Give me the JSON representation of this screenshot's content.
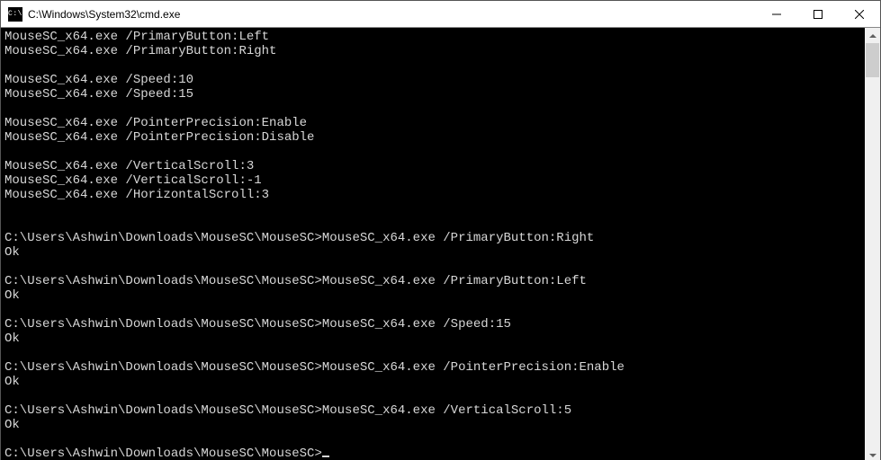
{
  "titlebar": {
    "icon_label": "C:\\",
    "title": "C:\\Windows\\System32\\cmd.exe",
    "minimize_label": "Minimize",
    "maximize_label": "Maximize",
    "close_label": "Close"
  },
  "console": {
    "usage_lines": [
      "MouseSC_x64.exe /PrimaryButton:Left",
      "MouseSC_x64.exe /PrimaryButton:Right",
      "",
      "MouseSC_x64.exe /Speed:10",
      "MouseSC_x64.exe /Speed:15",
      "",
      "MouseSC_x64.exe /PointerPrecision:Enable",
      "MouseSC_x64.exe /PointerPrecision:Disable",
      "",
      "MouseSC_x64.exe /VerticalScroll:3",
      "MouseSC_x64.exe /VerticalScroll:-1",
      "MouseSC_x64.exe /HorizontalScroll:3"
    ],
    "prompt_path": "C:\\Users\\Ashwin\\Downloads\\MouseSC\\MouseSC>",
    "sessions": [
      {
        "cmd": "MouseSC_x64.exe /PrimaryButton:Right",
        "out": "Ok"
      },
      {
        "cmd": "MouseSC_x64.exe /PrimaryButton:Left",
        "out": "Ok"
      },
      {
        "cmd": "MouseSC_x64.exe /Speed:15",
        "out": "Ok"
      },
      {
        "cmd": "MouseSC_x64.exe /PointerPrecision:Enable",
        "out": "Ok"
      },
      {
        "cmd": "MouseSC_x64.exe /VerticalScroll:5",
        "out": "Ok"
      }
    ],
    "final_prompt": "C:\\Users\\Ashwin\\Downloads\\MouseSC\\MouseSC>"
  },
  "scrollbar": {
    "up_label": "Scroll up",
    "down_label": "Scroll down"
  }
}
